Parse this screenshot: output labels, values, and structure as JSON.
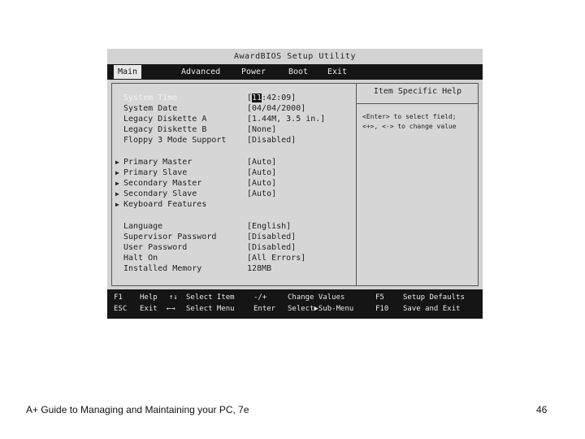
{
  "bios": {
    "title": "AwardBIOS Setup Utility",
    "menu": [
      "Main",
      "Advanced",
      "Power",
      "Boot",
      "Exit"
    ],
    "active_menu": "Main",
    "settings": [
      {
        "label": "System Time",
        "value_cursor": "11",
        "value_rest": ":42:09]",
        "selected": true,
        "submenu": false
      },
      {
        "label": "System Date",
        "value": "[04/04/2000]",
        "submenu": false
      },
      {
        "label": "Legacy Diskette A",
        "value": "[1.44M, 3.5 in.]",
        "submenu": false
      },
      {
        "label": "Legacy Diskette B",
        "value": "[None]",
        "submenu": false
      },
      {
        "label": "Floppy 3 Mode Support",
        "value": "[Disabled]",
        "submenu": false
      },
      {
        "label": "Primary Master",
        "value": "[Auto]",
        "submenu": true
      },
      {
        "label": "Primary Slave",
        "value": "[Auto]",
        "submenu": true
      },
      {
        "label": "Secondary Master",
        "value": "[Auto]",
        "submenu": true
      },
      {
        "label": "Secondary Slave",
        "value": "[Auto]",
        "submenu": true
      },
      {
        "label": "Keyboard Features",
        "value": "",
        "submenu": true
      },
      {
        "label": "Language",
        "value": "[English]",
        "submenu": false
      },
      {
        "label": "Supervisor Password",
        "value": "[Disabled]",
        "submenu": false
      },
      {
        "label": "User Password",
        "value": "[Disabled]",
        "submenu": false
      },
      {
        "label": "Halt On",
        "value": "[All Errors]",
        "submenu": false
      },
      {
        "label": "Installed Memory",
        "value": "128MB",
        "submenu": false
      }
    ],
    "help": {
      "title": "Item Specific Help",
      "lines": [
        "<Enter> to select field;",
        "<+>, <-> to change value"
      ]
    },
    "footer": {
      "row1": [
        {
          "key": "F1",
          "action": "Help"
        },
        {
          "key": "↑↓",
          "action": "Select Item"
        },
        {
          "key": "-/+",
          "action": "Change Values"
        },
        {
          "key": "F5",
          "action": "Setup Defaults"
        }
      ],
      "row2": [
        {
          "key": "ESC",
          "action": "Exit"
        },
        {
          "key": "←→",
          "action": "Select Menu"
        },
        {
          "key": "Enter",
          "action": "Select▶Sub-Menu"
        },
        {
          "key": "F10",
          "action": "Save and Exit"
        }
      ]
    }
  },
  "slide": {
    "footer_text": "A+ Guide to Managing and Maintaining your PC, 7e",
    "page_number": "46"
  },
  "colors": {
    "bios_background": "#d2d2d2",
    "bar_background": "#151515",
    "bar_text": "#e8e8e8"
  }
}
